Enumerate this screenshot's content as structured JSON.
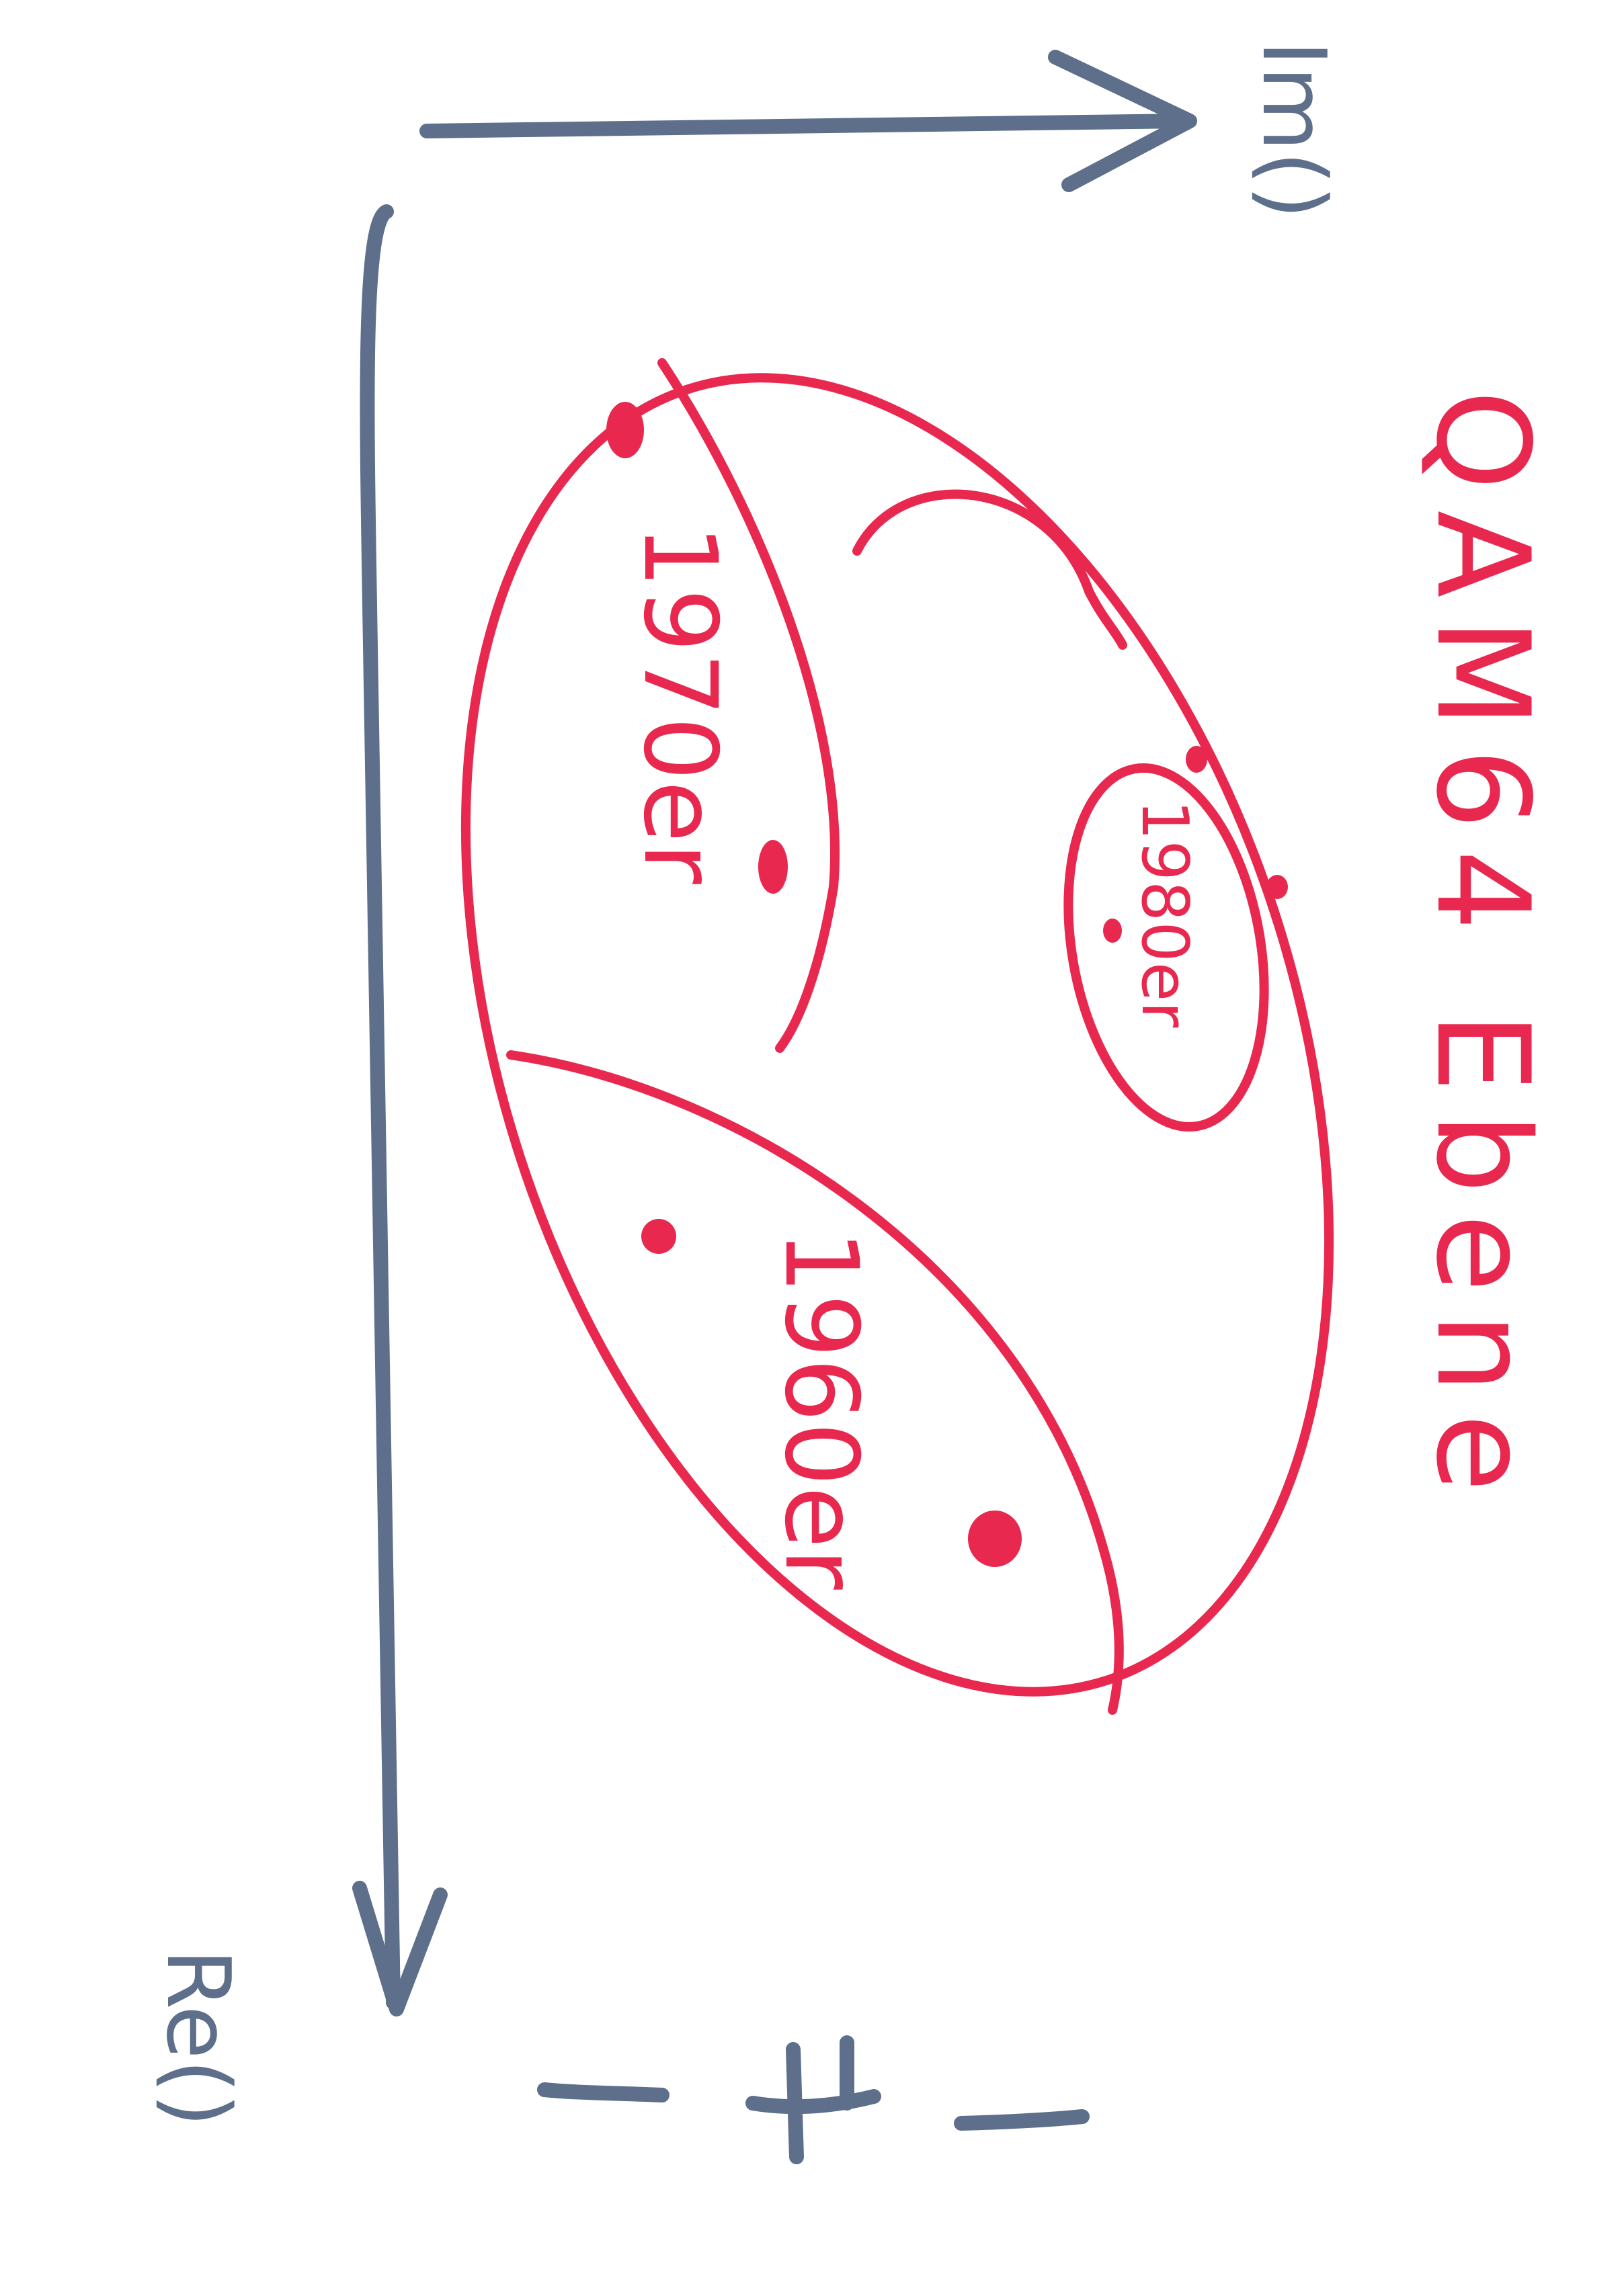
{
  "title": "QAM64 Ebene",
  "axes": {
    "imag_label": "Im()",
    "real_label": "Re()"
  },
  "regions": {
    "top": "1970er",
    "middle": "1980er",
    "bottom": "1960er"
  },
  "tick_label": "4",
  "colors": {
    "ink_red": "#e8284f",
    "ink_blue": "#5d6f8a",
    "paper": "#ffffff"
  }
}
